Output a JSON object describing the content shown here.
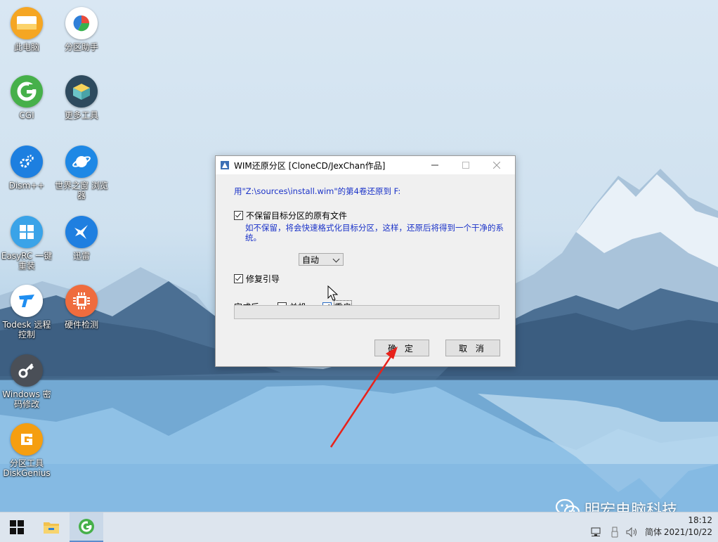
{
  "desktop": {
    "icons": [
      {
        "label": "此电脑",
        "icon": "computer-icon"
      },
      {
        "label": "分区助手",
        "icon": "partition-assistant-icon"
      },
      {
        "label": "CGI",
        "icon": "cgi-icon"
      },
      {
        "label": "更多工具",
        "icon": "toolbox-icon"
      },
      {
        "label": "Dism++",
        "icon": "dism-icon"
      },
      {
        "label": "世界之窗 浏览器",
        "icon": "browser-icon"
      },
      {
        "label": "EasyRC 一键重装",
        "icon": "windows-icon"
      },
      {
        "label": "迅雷",
        "icon": "thunder-icon"
      },
      {
        "label": "Todesk 远程控制",
        "icon": "todesk-icon"
      },
      {
        "label": "硬件检测",
        "icon": "chip-icon"
      },
      {
        "label": "Windows 密码修改",
        "icon": "key-icon"
      },
      {
        "label": "分区工具 DiskGenius",
        "icon": "diskgenius-icon"
      }
    ]
  },
  "dialog": {
    "title": "WIM还原分区 [CloneCD/JexChan作品]",
    "info": "用\"Z:\\sources\\install.wim\"的第4卷还原到 F:",
    "no_keep_label": "不保留目标分区的原有文件",
    "no_keep_checked": true,
    "no_keep_note": "如不保留，将会快速格式化目标分区，这样，还原后将得到一个干净的系统。",
    "repair_boot_label": "修复引导",
    "repair_boot_checked": true,
    "repair_boot_mode": "自动",
    "after_label": "完成后:",
    "shutdown_label": "关机",
    "shutdown_checked": false,
    "restart_label": "重启",
    "restart_checked": true,
    "progress": 0,
    "ok_label": "确 定",
    "cancel_label": "取 消"
  },
  "taskbar": {
    "ime": "简体",
    "time": "18:12",
    "date": "2021/10/22"
  },
  "watermark": "明宏电脑科技",
  "colors": {
    "info_text": "#1a32c8",
    "arrow": "#e8221b"
  }
}
